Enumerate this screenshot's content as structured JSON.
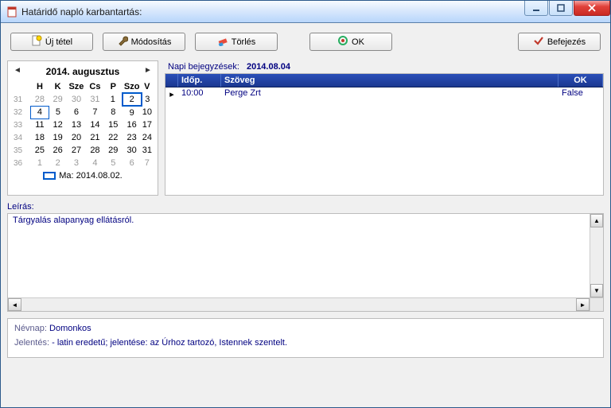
{
  "window": {
    "title": "Határidő napló karbantartás:"
  },
  "toolbar": {
    "new_label": "Új tétel",
    "edit_label": "Módosítás",
    "delete_label": "Törlés",
    "ok_label": "OK",
    "finish_label": "Befejezés"
  },
  "calendar": {
    "title": "2014. augusztus",
    "dow": [
      "H",
      "K",
      "Sze",
      "Cs",
      "P",
      "Szo",
      "V"
    ],
    "weeks": [
      {
        "wk": "31",
        "d": [
          {
            "n": "28",
            "dim": true
          },
          {
            "n": "29",
            "dim": true
          },
          {
            "n": "30",
            "dim": true
          },
          {
            "n": "31",
            "dim": true
          },
          {
            "n": "1"
          },
          {
            "n": "2",
            "today": true
          },
          {
            "n": "3"
          }
        ]
      },
      {
        "wk": "32",
        "d": [
          {
            "n": "4",
            "sel": true
          },
          {
            "n": "5"
          },
          {
            "n": "6"
          },
          {
            "n": "7"
          },
          {
            "n": "8"
          },
          {
            "n": "9"
          },
          {
            "n": "10"
          }
        ]
      },
      {
        "wk": "33",
        "d": [
          {
            "n": "11"
          },
          {
            "n": "12"
          },
          {
            "n": "13"
          },
          {
            "n": "14"
          },
          {
            "n": "15"
          },
          {
            "n": "16"
          },
          {
            "n": "17"
          }
        ]
      },
      {
        "wk": "34",
        "d": [
          {
            "n": "18"
          },
          {
            "n": "19"
          },
          {
            "n": "20"
          },
          {
            "n": "21"
          },
          {
            "n": "22"
          },
          {
            "n": "23"
          },
          {
            "n": "24"
          }
        ]
      },
      {
        "wk": "35",
        "d": [
          {
            "n": "25"
          },
          {
            "n": "26"
          },
          {
            "n": "27"
          },
          {
            "n": "28"
          },
          {
            "n": "29"
          },
          {
            "n": "30"
          },
          {
            "n": "31"
          }
        ]
      },
      {
        "wk": "36",
        "d": [
          {
            "n": "1",
            "dim": true
          },
          {
            "n": "2",
            "dim": true
          },
          {
            "n": "3",
            "dim": true
          },
          {
            "n": "4",
            "dim": true
          },
          {
            "n": "5",
            "dim": true
          },
          {
            "n": "6",
            "dim": true
          },
          {
            "n": "7",
            "dim": true
          }
        ]
      }
    ],
    "today_label": "Ma: 2014.08.02."
  },
  "entries": {
    "label": "Napi bejegyzések:",
    "date": "2014.08.04",
    "cols": {
      "time": "Időp.",
      "text": "Szöveg",
      "ok": "OK"
    },
    "rows": [
      {
        "time": "10:00",
        "text": "Perge Zrt",
        "ok": "False"
      }
    ]
  },
  "description": {
    "label": "Leírás:",
    "text": "Tárgyalás alapanyag ellátásról."
  },
  "info": {
    "nameday_label": "Névnap:",
    "nameday_value": "Domonkos",
    "meaning_label": "Jelentés:",
    "meaning_value": "- latin eredetű; jelentése: az Úrhoz tartozó, Istennek szentelt."
  }
}
